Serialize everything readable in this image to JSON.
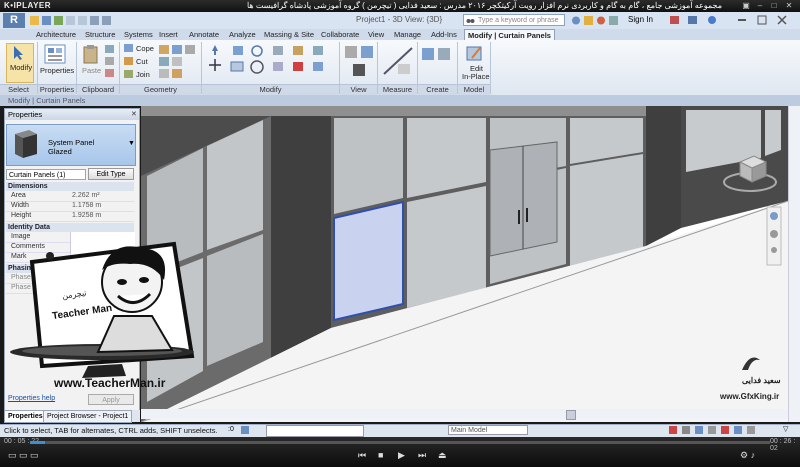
{
  "player": {
    "brand": "K•IPLAYER",
    "title": "مجموعه آموزشی جامع ، گام به گام و کاربردی نرم افزار رویت آرکیتکچر ۲۰۱۶  مدرس : سعید فدایی ( تیچرمن ) گروه آموزشی پادشاه گرافیست ها",
    "time_current": "00 : 05 : 22",
    "time_total": "00 : 26 : 02",
    "progress": 0.02
  },
  "revit": {
    "doc_title": "Project1 - 3D View: {3D}",
    "search_placeholder": "Type a keyword or phrase",
    "signin": "Sign In",
    "tabs": [
      "Architecture",
      "Structure",
      "Systems",
      "Insert",
      "Annotate",
      "Analyze",
      "Massing & Site",
      "Collaborate",
      "View",
      "Manage",
      "Add-Ins",
      "Modify | Curtain Panels"
    ],
    "ribbon": {
      "modify_label": "Modify",
      "properties_label": "Properties",
      "paste_label": "Paste",
      "cope_label": "Cope",
      "cut_label": "Cut",
      "join_label": "Join",
      "edit_inplace_label1": "Edit",
      "edit_inplace_label2": "In-Place",
      "panels": [
        "Select",
        "Properties",
        "Clipboard",
        "Geometry",
        "Modify",
        "View",
        "Measure",
        "Create",
        "Model"
      ]
    },
    "context_label": "Modify | Curtain Panels"
  },
  "properties": {
    "header": "Properties",
    "type_line1": "System Panel",
    "type_line2": "Glazed",
    "instance_filter": "Curtain Panels (1)",
    "edit_type": "Edit Type",
    "groups": {
      "dimensions": "Dimensions",
      "identity": "Identity Data",
      "phasing": "Phasing"
    },
    "rows": {
      "area_k": "Area",
      "area_v": "2.262 m²",
      "width_k": "Width",
      "width_v": "1.1758 m",
      "height_k": "Height",
      "height_v": "1.9258 m",
      "image_k": "Image",
      "comments_k": "Comments",
      "mark_k": "Mark",
      "phase_created_k": "Phase Cr",
      "phase_demo_k": "Phase De"
    },
    "help": "Properties help",
    "apply": "Apply",
    "tab_properties": "Properties",
    "tab_browser": "Project Browser - Project1"
  },
  "overlay": {
    "www": "www.TeacherMan.ir",
    "brand": "Teacher Man",
    "brand_sub": "تیچرمن",
    "gfx_url": "www.GfxKing.ir",
    "gfx_name": "سعید فدایی"
  },
  "status": {
    "text": "Click to select, TAB for alternates, CTRL adds, SHIFT unselects.",
    "model": "Main Model",
    "zero": ":0"
  }
}
